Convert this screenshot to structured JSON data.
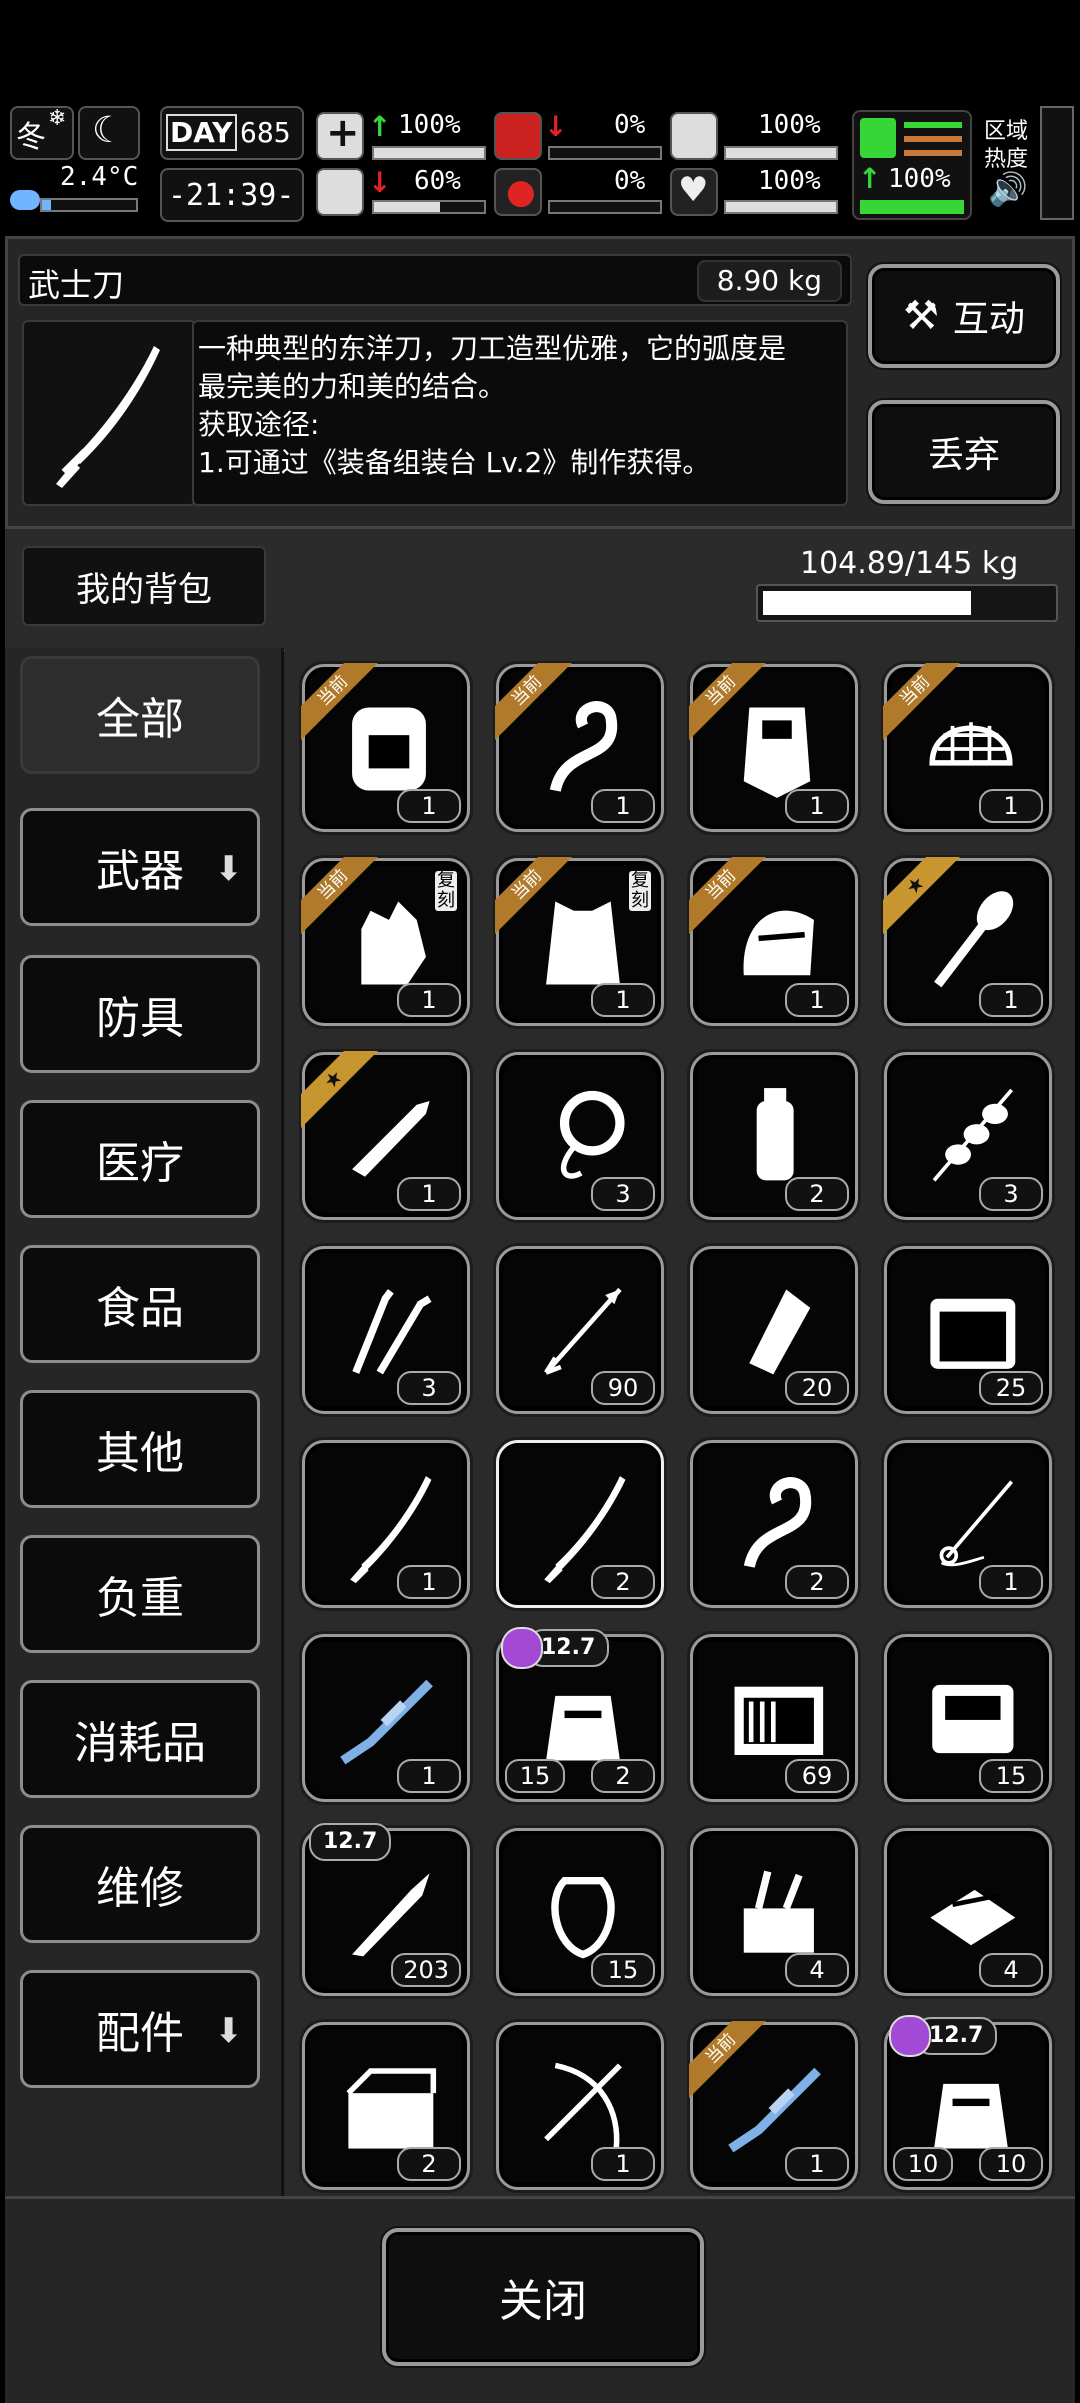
{
  "status": {
    "season": "冬",
    "temperature": "2.4°C",
    "day_label": "DAY",
    "day_number": "685",
    "clock": "-21:39-",
    "health_pct": "100%",
    "stomach_pct": "60%",
    "hunger_pct": "0%",
    "blood_pct": "0%",
    "armor_pct": "100%",
    "heart_pct": "100%",
    "stamina_pct": "100%",
    "zone_label": "区域热度",
    "colors": {
      "up": "#35d635",
      "down": "#e02424",
      "stamina": "#35d635"
    }
  },
  "item": {
    "name": "武士刀",
    "weight": "8.90 kg",
    "description_lines": [
      "一种典型的东洋刀，刀工造型优雅，它的弧度是",
      "最完美的力和美的结合。",
      "获取途径:",
      "1.可通过《装备组装台 Lv.2》制作获得。"
    ],
    "interact_label": "互动",
    "discard_label": "丢弃"
  },
  "backpack": {
    "title": "我的背包",
    "capacity": "104.89/145 kg",
    "fill_fraction": 0.7234
  },
  "categories": [
    {
      "label": "全部",
      "active": true,
      "dropdown": false
    },
    {
      "label": "武器",
      "active": false,
      "dropdown": true
    },
    {
      "label": "防具",
      "active": false,
      "dropdown": false
    },
    {
      "label": "医疗",
      "active": false,
      "dropdown": false
    },
    {
      "label": "食品",
      "active": false,
      "dropdown": false
    },
    {
      "label": "其他",
      "active": false,
      "dropdown": false
    },
    {
      "label": "负重",
      "active": false,
      "dropdown": false
    },
    {
      "label": "消耗品",
      "active": false,
      "dropdown": false
    },
    {
      "label": "维修",
      "active": false,
      "dropdown": false
    },
    {
      "label": "配件",
      "active": false,
      "dropdown": true
    }
  ],
  "ribbon_equipped": "当前",
  "items": [
    {
      "icon": "backpack-icon",
      "count": "1",
      "badge": "equipped"
    },
    {
      "icon": "whip-icon",
      "count": "1",
      "badge": "equipped"
    },
    {
      "icon": "riot-shield-icon",
      "count": "1",
      "badge": "equipped"
    },
    {
      "icon": "helmet-net-icon",
      "count": "1",
      "badge": "equipped"
    },
    {
      "icon": "gloves-icon",
      "count": "1",
      "badge": "equipped",
      "tag": "复刻"
    },
    {
      "icon": "armor-vest-icon",
      "count": "1",
      "badge": "equipped",
      "tag": "复刻"
    },
    {
      "icon": "knight-helmet-icon",
      "count": "1",
      "badge": "equipped"
    },
    {
      "icon": "shovel-icon",
      "count": "1",
      "badge": "star"
    },
    {
      "icon": "machete-icon",
      "count": "1",
      "badge": "star"
    },
    {
      "icon": "rope-icon",
      "count": "3",
      "badge": ""
    },
    {
      "icon": "water-bottle-icon",
      "count": "2",
      "badge": ""
    },
    {
      "icon": "skewer-icon",
      "count": "3",
      "badge": ""
    },
    {
      "icon": "lockpick-icon",
      "count": "3",
      "badge": ""
    },
    {
      "icon": "arrow-icon",
      "count": "90",
      "badge": ""
    },
    {
      "icon": "cloth-icon",
      "count": "20",
      "badge": ""
    },
    {
      "icon": "toolkit-icon",
      "count": "25",
      "badge": ""
    },
    {
      "icon": "katana-icon",
      "count": "1",
      "badge": ""
    },
    {
      "icon": "katana-icon",
      "count": "2",
      "badge": "",
      "selected": true
    },
    {
      "icon": "whip-icon",
      "count": "2",
      "badge": ""
    },
    {
      "icon": "rapier-icon",
      "count": "1",
      "badge": ""
    },
    {
      "icon": "sniper-rifle-icon",
      "count": "1",
      "badge": ""
    },
    {
      "icon": "ammo-bag-icon",
      "count": "2",
      "count_left": "15",
      "caliber": "12.7",
      "caliber_icon": true
    },
    {
      "icon": "ammo-crate-icon",
      "count": "69",
      "badge": ""
    },
    {
      "icon": "radio-device-icon",
      "count": "15",
      "badge": ""
    },
    {
      "icon": "bullet-icon",
      "count": "203",
      "caliber": "12.7"
    },
    {
      "icon": "sling-bag-icon",
      "count": "15",
      "badge": ""
    },
    {
      "icon": "tool-box-icon",
      "count": "4",
      "badge": ""
    },
    {
      "icon": "pliers-case-icon",
      "count": "4",
      "badge": ""
    },
    {
      "icon": "crate-open-icon",
      "count": "2",
      "badge": ""
    },
    {
      "icon": "crossbow-icon",
      "count": "1",
      "badge": ""
    },
    {
      "icon": "sniper-rifle-icon",
      "count": "1",
      "badge": "equipped"
    },
    {
      "icon": "ammo-bag-icon",
      "count": "10",
      "count_left": "10",
      "caliber": "12.7",
      "caliber_icon": true
    }
  ],
  "close_label": "关闭"
}
